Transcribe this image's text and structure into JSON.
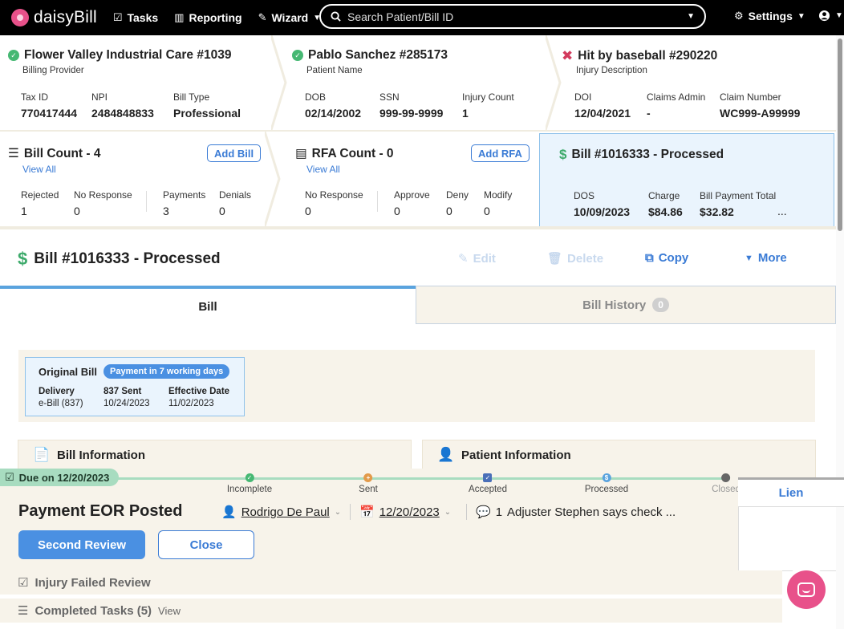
{
  "nav": {
    "brand": "daisyBill",
    "tasks": "Tasks",
    "reporting": "Reporting",
    "wizard": "Wizard",
    "search_placeholder": "Search Patient/Bill ID",
    "settings": "Settings"
  },
  "provider": {
    "title": "Flower Valley Industrial Care #1039",
    "subtitle": "Billing Provider",
    "fields": [
      {
        "label": "Tax ID",
        "value": "770417444"
      },
      {
        "label": "NPI",
        "value": "2484848833"
      },
      {
        "label": "Bill Type",
        "value": "Professional"
      }
    ]
  },
  "patient": {
    "title": "Pablo Sanchez #285173",
    "subtitle": "Patient Name",
    "fields": [
      {
        "label": "DOB",
        "value": "02/14/2002"
      },
      {
        "label": "SSN",
        "value": "999-99-9999"
      },
      {
        "label": "Injury Count",
        "value": "1"
      }
    ]
  },
  "injury": {
    "title": "Hit by baseball #290220",
    "subtitle": "Injury Description",
    "fields": [
      {
        "label": "DOI",
        "value": "12/04/2021"
      },
      {
        "label": "Claims Admin",
        "value": "-"
      },
      {
        "label": "Claim Number",
        "value": "WC999-A99999"
      }
    ]
  },
  "bill_count": {
    "title": "Bill Count - 4",
    "view_all": "View All",
    "add_label": "Add Bill",
    "fields": [
      {
        "label": "Rejected",
        "value": "1"
      },
      {
        "label": "No Response",
        "value": "0"
      },
      {
        "label": "Payments",
        "value": "3"
      },
      {
        "label": "Denials",
        "value": "0"
      }
    ]
  },
  "rfa_count": {
    "title": "RFA Count - 0",
    "view_all": "View All",
    "add_label": "Add RFA",
    "fields": [
      {
        "label": "No Response",
        "value": "0"
      },
      {
        "label": "Approve",
        "value": "0"
      },
      {
        "label": "Deny",
        "value": "0"
      },
      {
        "label": "Modify",
        "value": "0"
      }
    ]
  },
  "bill_card": {
    "title": "Bill #1016333 - Processed",
    "fields": [
      {
        "label": "DOS",
        "value": "10/09/2023"
      },
      {
        "label": "Charge",
        "value": "$84.86"
      },
      {
        "label": "Bill Payment Total",
        "value": "$32.82"
      }
    ],
    "ellipsis": "..."
  },
  "bill_header": {
    "title": "Bill #1016333 - Processed",
    "edit": "Edit",
    "delete": "Delete",
    "copy": "Copy",
    "more": "More"
  },
  "tabs": {
    "bill": "Bill",
    "history": "Bill History",
    "history_count": "0"
  },
  "original_bill": {
    "title": "Original Bill",
    "badge": "Payment in 7 working days",
    "fields": [
      {
        "label": "Delivery",
        "value": "e-Bill (837)"
      },
      {
        "label": "837 Sent",
        "value": "10/24/2023"
      },
      {
        "label": "Effective Date",
        "value": "11/02/2023"
      }
    ]
  },
  "panels": {
    "bill_info": "Bill Information",
    "patient_info": "Patient Information"
  },
  "task": {
    "due": "Due on 12/20/2023",
    "steps": [
      "Incomplete",
      "Sent",
      "Accepted",
      "Processed",
      "Closed"
    ],
    "title": "Payment EOR Posted",
    "assignee": "Rodrigo De Paul",
    "date": "12/20/2023",
    "comment_count": "1",
    "comment": "Adjuster Stephen says check ...",
    "primary_btn": "Second Review",
    "secondary_btn": "Close",
    "lien_tab": "Lien"
  },
  "bottom_tasks": {
    "failed": "Injury Failed Review",
    "completed": "Completed Tasks (5)",
    "view": "View"
  },
  "colors": {
    "accent_blue": "#3a7bd5",
    "brand_pink": "#e8518a",
    "success_green": "#46b873",
    "due_green": "#a8dcc0"
  }
}
